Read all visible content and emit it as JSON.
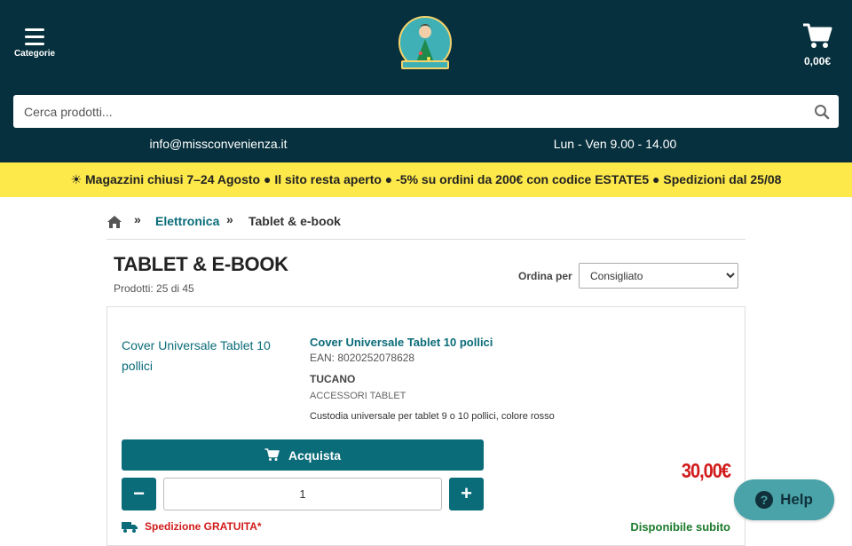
{
  "header": {
    "menu_label": "Categorie",
    "cart_amount": "0,00€",
    "search_placeholder": "Cerca prodotti...",
    "email": "info@missconvenienza.it",
    "hours": "Lun - Ven 9.00 - 14.00",
    "logo_icon": "missconvenienza-logo"
  },
  "banner": {
    "text": "☀ Magazzini chiusi 7–24 Agosto ● Il sito resta aperto ● -5% su ordini da 200€ con codice ESTATE5 ● Spedizioni dal 25/08"
  },
  "breadcrumb": {
    "items": [
      "Elettronica",
      "Tablet & e-book"
    ]
  },
  "listing": {
    "title": "TABLET & E-BOOK",
    "count": "Prodotti: 25 di 45",
    "sort_label": "Ordina per",
    "sort_selected": "Consigliato"
  },
  "product": {
    "image_alt": "Cover Universale Tablet 10 pollici",
    "name": "Cover Universale Tablet 10 pollici",
    "ean": "EAN: 8020252078628",
    "brand": "TUCANO",
    "category": "ACCESSORI TABLET",
    "description": "Custodia universale per tablet 9 o 10 pollici, colore rosso",
    "buy_label": "Acquista",
    "quantity": "1",
    "price": "30,00€",
    "shipping": "Spedizione GRATUITA*",
    "availability": "Disponibile subito"
  },
  "help": {
    "label": "Help"
  },
  "colors": {
    "header_bg": "#06303d",
    "accent": "#0a6c79",
    "banner_bg": "#fde94a",
    "price": "#d21a1a",
    "available": "#1c7a2c"
  }
}
